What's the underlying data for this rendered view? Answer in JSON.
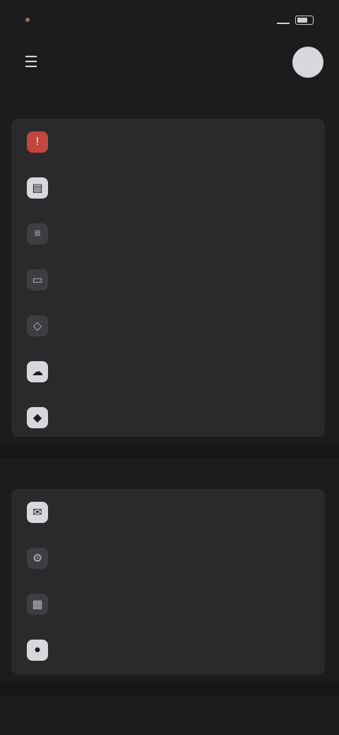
{
  "status_bar": {
    "time": "",
    "signal_icon": "signal-icon",
    "battery_icon": "battery-icon"
  },
  "app_bar": {
    "menu_icon": "menu-icon",
    "title": "",
    "avatar_icon": "avatar-icon"
  },
  "sections": [
    {
      "label": "",
      "items": [
        {
          "label": "",
          "icon": "alert-icon"
        },
        {
          "label": "",
          "icon": "document-icon"
        },
        {
          "label": "",
          "icon": "list-icon"
        },
        {
          "label": "",
          "icon": "folder-icon"
        },
        {
          "label": "",
          "icon": "tag-icon"
        },
        {
          "label": "",
          "icon": "cloud-icon"
        },
        {
          "label": "",
          "icon": "shield-icon"
        }
      ]
    },
    {
      "label": "",
      "items": [
        {
          "label": "",
          "icon": "mail-icon"
        },
        {
          "label": "",
          "icon": "settings-icon"
        },
        {
          "label": "",
          "icon": "calendar-icon"
        },
        {
          "label": "",
          "icon": "user-icon"
        }
      ]
    },
    {
      "label": ""
    }
  ]
}
